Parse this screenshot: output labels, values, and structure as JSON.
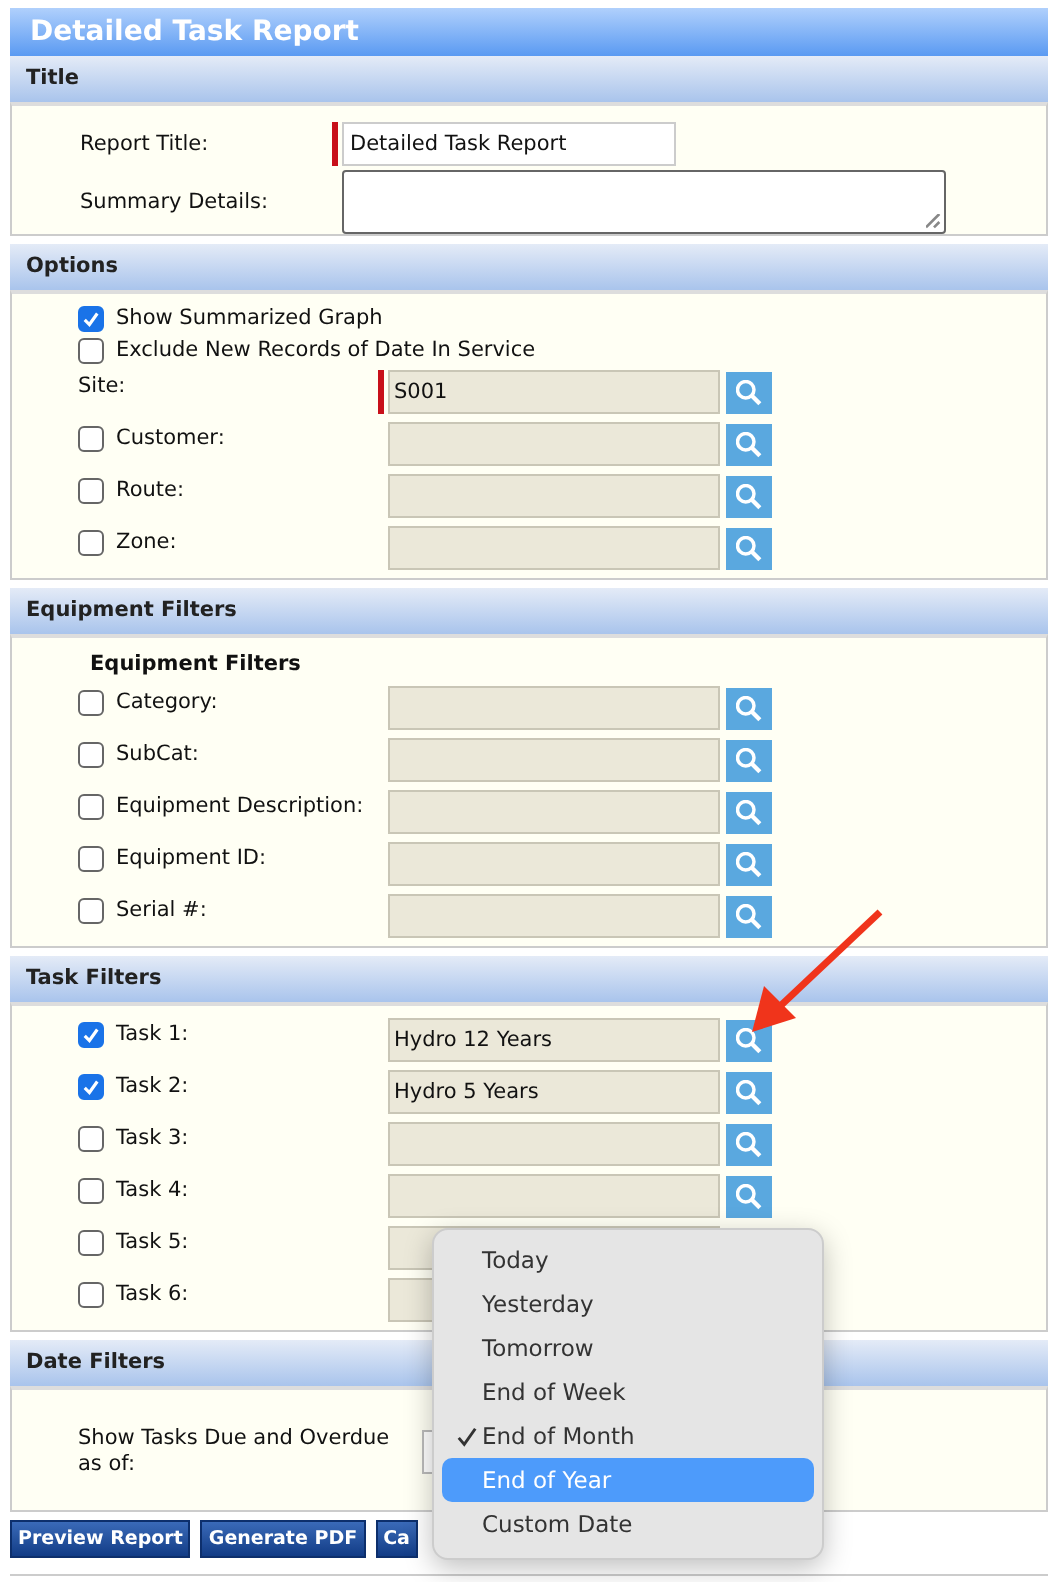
{
  "title": "Detailed Task Report",
  "sections": [
    {
      "heading": "Title",
      "rows": [
        {
          "kind": "text",
          "label": "Report Title:",
          "value": "Detailed Task Report",
          "required": true
        },
        {
          "kind": "textarea",
          "label": "Summary Details:"
        }
      ]
    },
    {
      "heading": "Options",
      "rows": [
        {
          "kind": "check",
          "label": "Show Summarized Graph",
          "checked": true
        },
        {
          "kind": "check",
          "label": "Exclude New Records of Date In Service",
          "checked": false
        },
        {
          "kind": "lookup",
          "label": "Site:",
          "value": "S001",
          "required": true
        },
        {
          "kind": "lookup",
          "label": "Customer:",
          "checked": false,
          "required": false
        },
        {
          "kind": "lookup",
          "label": "Route:",
          "checked": false,
          "required": false
        },
        {
          "kind": "lookup",
          "label": "Zone:",
          "checked": false,
          "required": false
        }
      ]
    },
    {
      "heading": "Equipment Filters",
      "rows": [
        {
          "kind": "subheading",
          "label": "Equipment Filters"
        },
        {
          "kind": "lookup",
          "label": "Category:",
          "checked": false,
          "required": false
        },
        {
          "kind": "lookup",
          "label": "SubCat:",
          "checked": false,
          "required": false
        },
        {
          "kind": "lookup",
          "label": "Equipment Description:",
          "checked": false,
          "required": false
        },
        {
          "kind": "lookup",
          "label": "Equipment ID:",
          "checked": false,
          "required": false
        },
        {
          "kind": "lookup",
          "label": "Serial #:",
          "checked": false,
          "required": false
        }
      ]
    },
    {
      "heading": "Task Filters",
      "rows": [
        {
          "kind": "lookup",
          "label": "Task 1:",
          "value": "Hydro 12 Years",
          "checked": true,
          "required": false
        },
        {
          "kind": "lookup",
          "label": "Task 2:",
          "value": "Hydro 5 Years",
          "checked": true,
          "required": false
        },
        {
          "kind": "lookup",
          "label": "Task 3:",
          "checked": false,
          "required": false
        },
        {
          "kind": "lookup",
          "label": "Task 4:",
          "checked": false,
          "required": false
        },
        {
          "kind": "lookup",
          "label": "Task 5:",
          "checked": false,
          "required": false
        },
        {
          "kind": "lookup",
          "label": "Task 6:",
          "checked": false,
          "required": false
        }
      ]
    },
    {
      "heading": "Date Filters",
      "rows": [
        {
          "kind": "select",
          "label": "Show Tasks Due and Overdue as of:"
        }
      ]
    }
  ],
  "buttons": [
    "Preview Report",
    "Generate PDF",
    "Ca"
  ],
  "menu": {
    "items": [
      {
        "label": "Today",
        "checked": false,
        "highlighted": false
      },
      {
        "label": "Yesterday",
        "checked": false,
        "highlighted": false
      },
      {
        "label": "Tomorrow",
        "checked": false,
        "highlighted": false
      },
      {
        "label": "End of Week",
        "checked": false,
        "highlighted": false
      },
      {
        "label": "End of Month",
        "checked": true,
        "highlighted": false
      },
      {
        "label": "End of Year",
        "checked": false,
        "highlighted": true
      },
      {
        "label": "Custom Date",
        "checked": false,
        "highlighted": false
      }
    ]
  }
}
